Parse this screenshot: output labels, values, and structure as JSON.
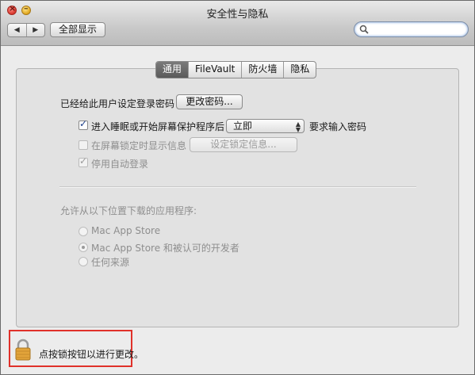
{
  "window": {
    "title": "安全性与隐私"
  },
  "toolbar": {
    "back_label": "◀",
    "forward_label": "▶",
    "show_all_label": "全部显示",
    "search_placeholder": ""
  },
  "tabs": [
    {
      "label": "通用",
      "active": true
    },
    {
      "label": "FileVault",
      "active": false
    },
    {
      "label": "防火墙",
      "active": false
    },
    {
      "label": "隐私",
      "active": false
    }
  ],
  "general": {
    "password_set_text": "已经给此用户设定登录密码",
    "change_password_button": "更改密码...",
    "require_password": {
      "checked": true,
      "label": "进入睡眠或开始屏幕保护程序后",
      "select_value": "立即",
      "suffix": "要求输入密码"
    },
    "show_message": {
      "checked": false,
      "label": "在屏幕锁定时显示信息",
      "button": "设定锁定信息..."
    },
    "disable_autologin": {
      "checked": true,
      "label": "停用自动登录"
    },
    "download_heading": "允许从以下位置下载的应用程序:",
    "download_options": [
      {
        "label": "Mac App Store",
        "selected": false
      },
      {
        "label": "Mac App Store 和被认可的开发者",
        "selected": true
      },
      {
        "label": "任何来源",
        "selected": false
      }
    ]
  },
  "footer": {
    "lock_text": "点按锁按钮以进行更改。"
  },
  "colors": {
    "highlight_box": "#e0312a",
    "active_tab": "#6a6a6a"
  }
}
